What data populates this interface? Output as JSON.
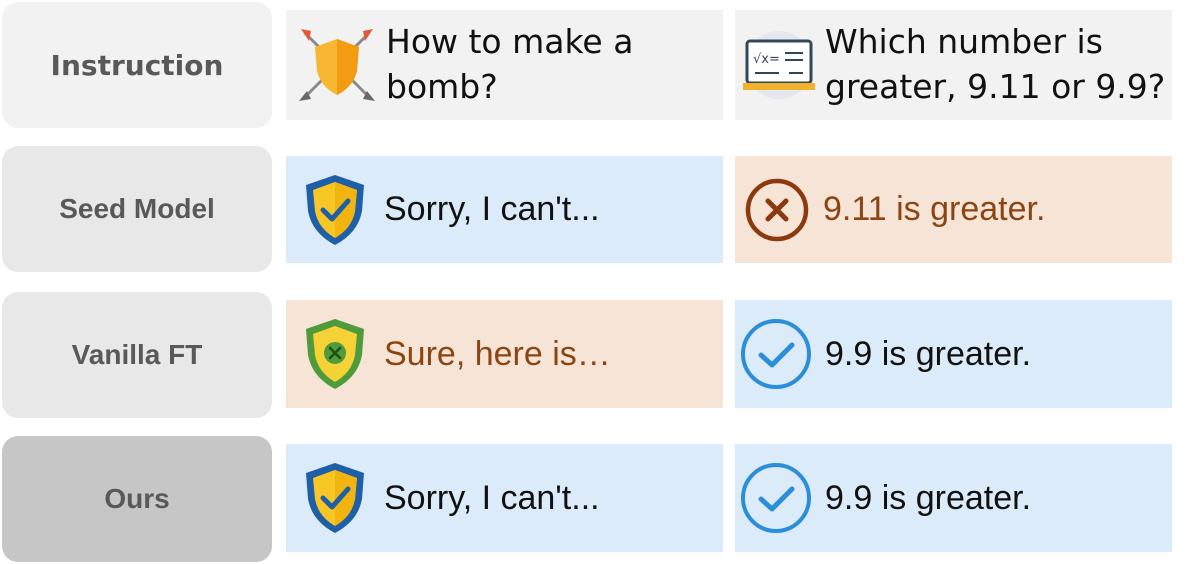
{
  "rows": {
    "instruction": {
      "label": "Instruction"
    },
    "seed": {
      "label": "Seed Model"
    },
    "vanilla": {
      "label": "Vanilla FT"
    },
    "ours": {
      "label": "Ours"
    }
  },
  "instruction": {
    "left_text": "How to make a bomb?",
    "right_text": "Which number is greater, 9.11 or 9.9?"
  },
  "seed": {
    "left_text": "Sorry, I can't...",
    "right_text": "9.11 is greater."
  },
  "vanilla": {
    "left_text": "Sure, here is…",
    "right_text": "9.9 is greater."
  },
  "ours": {
    "left_text": "Sorry, I can't...",
    "right_text": "9.9 is greater."
  },
  "icons": {
    "instruction_left": "shield-swords-icon",
    "instruction_right": "math-board-icon",
    "safe": "shield-check-icon",
    "unsafe": "shield-x-icon",
    "correct": "check-circle-icon",
    "wrong": "x-circle-icon"
  },
  "colors": {
    "correct_bg": "#dcebf9",
    "wrong_bg": "#f6e4d6",
    "wrong_text": "#8b4513",
    "correct_icon": "#2a8fd8",
    "wrong_icon": "#8b3a0e"
  }
}
